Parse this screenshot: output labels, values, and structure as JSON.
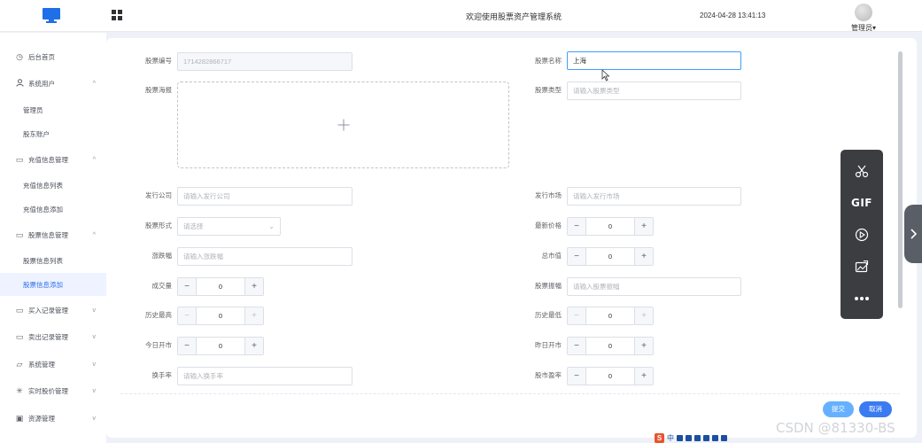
{
  "header": {
    "title": "欢迎使用股票资产管理系统",
    "datetime": "2024-04-28 13:41:13",
    "user": "管理员▾"
  },
  "sidebar": {
    "items": [
      {
        "label": "后台首页",
        "icon": "clock-icon"
      },
      {
        "label": "系统用户",
        "icon": "user-icon",
        "chevron": "^"
      },
      {
        "label": "管理员"
      },
      {
        "label": "股东账户"
      },
      {
        "label": "充值信息管理",
        "icon": "document-icon",
        "chevron": "^"
      },
      {
        "label": "充值信息列表"
      },
      {
        "label": "充值信息添加"
      },
      {
        "label": "股票信息管理",
        "icon": "document-icon",
        "chevron": "^"
      },
      {
        "label": "股票信息列表"
      },
      {
        "label": "股票信息添加"
      },
      {
        "label": "买入记录管理",
        "icon": "document-icon",
        "chevron": "v"
      },
      {
        "label": "卖出记录管理",
        "icon": "document-icon",
        "chevron": "v"
      },
      {
        "label": "系统管理",
        "icon": "folder-icon",
        "chevron": "v"
      },
      {
        "label": "实时股价管理",
        "icon": "sun-icon",
        "chevron": "v"
      },
      {
        "label": "资源管理",
        "icon": "monitor-icon",
        "chevron": "v"
      }
    ]
  },
  "form": {
    "stock_code": {
      "label": "股票编号",
      "value": "1714282866717"
    },
    "stock_name": {
      "label": "股票名称",
      "value": "上海"
    },
    "poster": {
      "label": "股票海报"
    },
    "stock_type": {
      "label": "股票类型",
      "placeholder": "请输入股票类型"
    },
    "issuer": {
      "label": "发行公司",
      "placeholder": "请输入发行公司"
    },
    "market": {
      "label": "发行市场",
      "placeholder": "请输入发行市场"
    },
    "form_type": {
      "label": "股票形式",
      "placeholder": "请选择"
    },
    "latest_price": {
      "label": "最新价格",
      "value": "0"
    },
    "change_pct": {
      "label": "涨跌幅",
      "placeholder": "请输入涨跌幅"
    },
    "market_cap": {
      "label": "总市值",
      "value": "0"
    },
    "volume": {
      "label": "成交量",
      "value": "0"
    },
    "amplitude": {
      "label": "股票振幅",
      "placeholder": "请输入股票振幅"
    },
    "hist_high": {
      "label": "历史最高",
      "value": "0"
    },
    "hist_low": {
      "label": "历史最低",
      "value": "0"
    },
    "today_open": {
      "label": "今日开市",
      "value": "0"
    },
    "yesterday_open": {
      "label": "昨日开市",
      "value": "0"
    },
    "turnover": {
      "label": "换手率",
      "placeholder": "请输入换手率"
    },
    "pe_ratio": {
      "label": "股市盈率",
      "value": "0"
    },
    "submit": "提交",
    "cancel": "取消"
  },
  "toolbar": {
    "gif": "GIF",
    "icons": [
      "scissors-icon",
      "gif-icon",
      "record-icon",
      "image-icon",
      "more-icon"
    ]
  },
  "watermark": "CSDN @81330-BS",
  "ime": {
    "label": "中"
  }
}
